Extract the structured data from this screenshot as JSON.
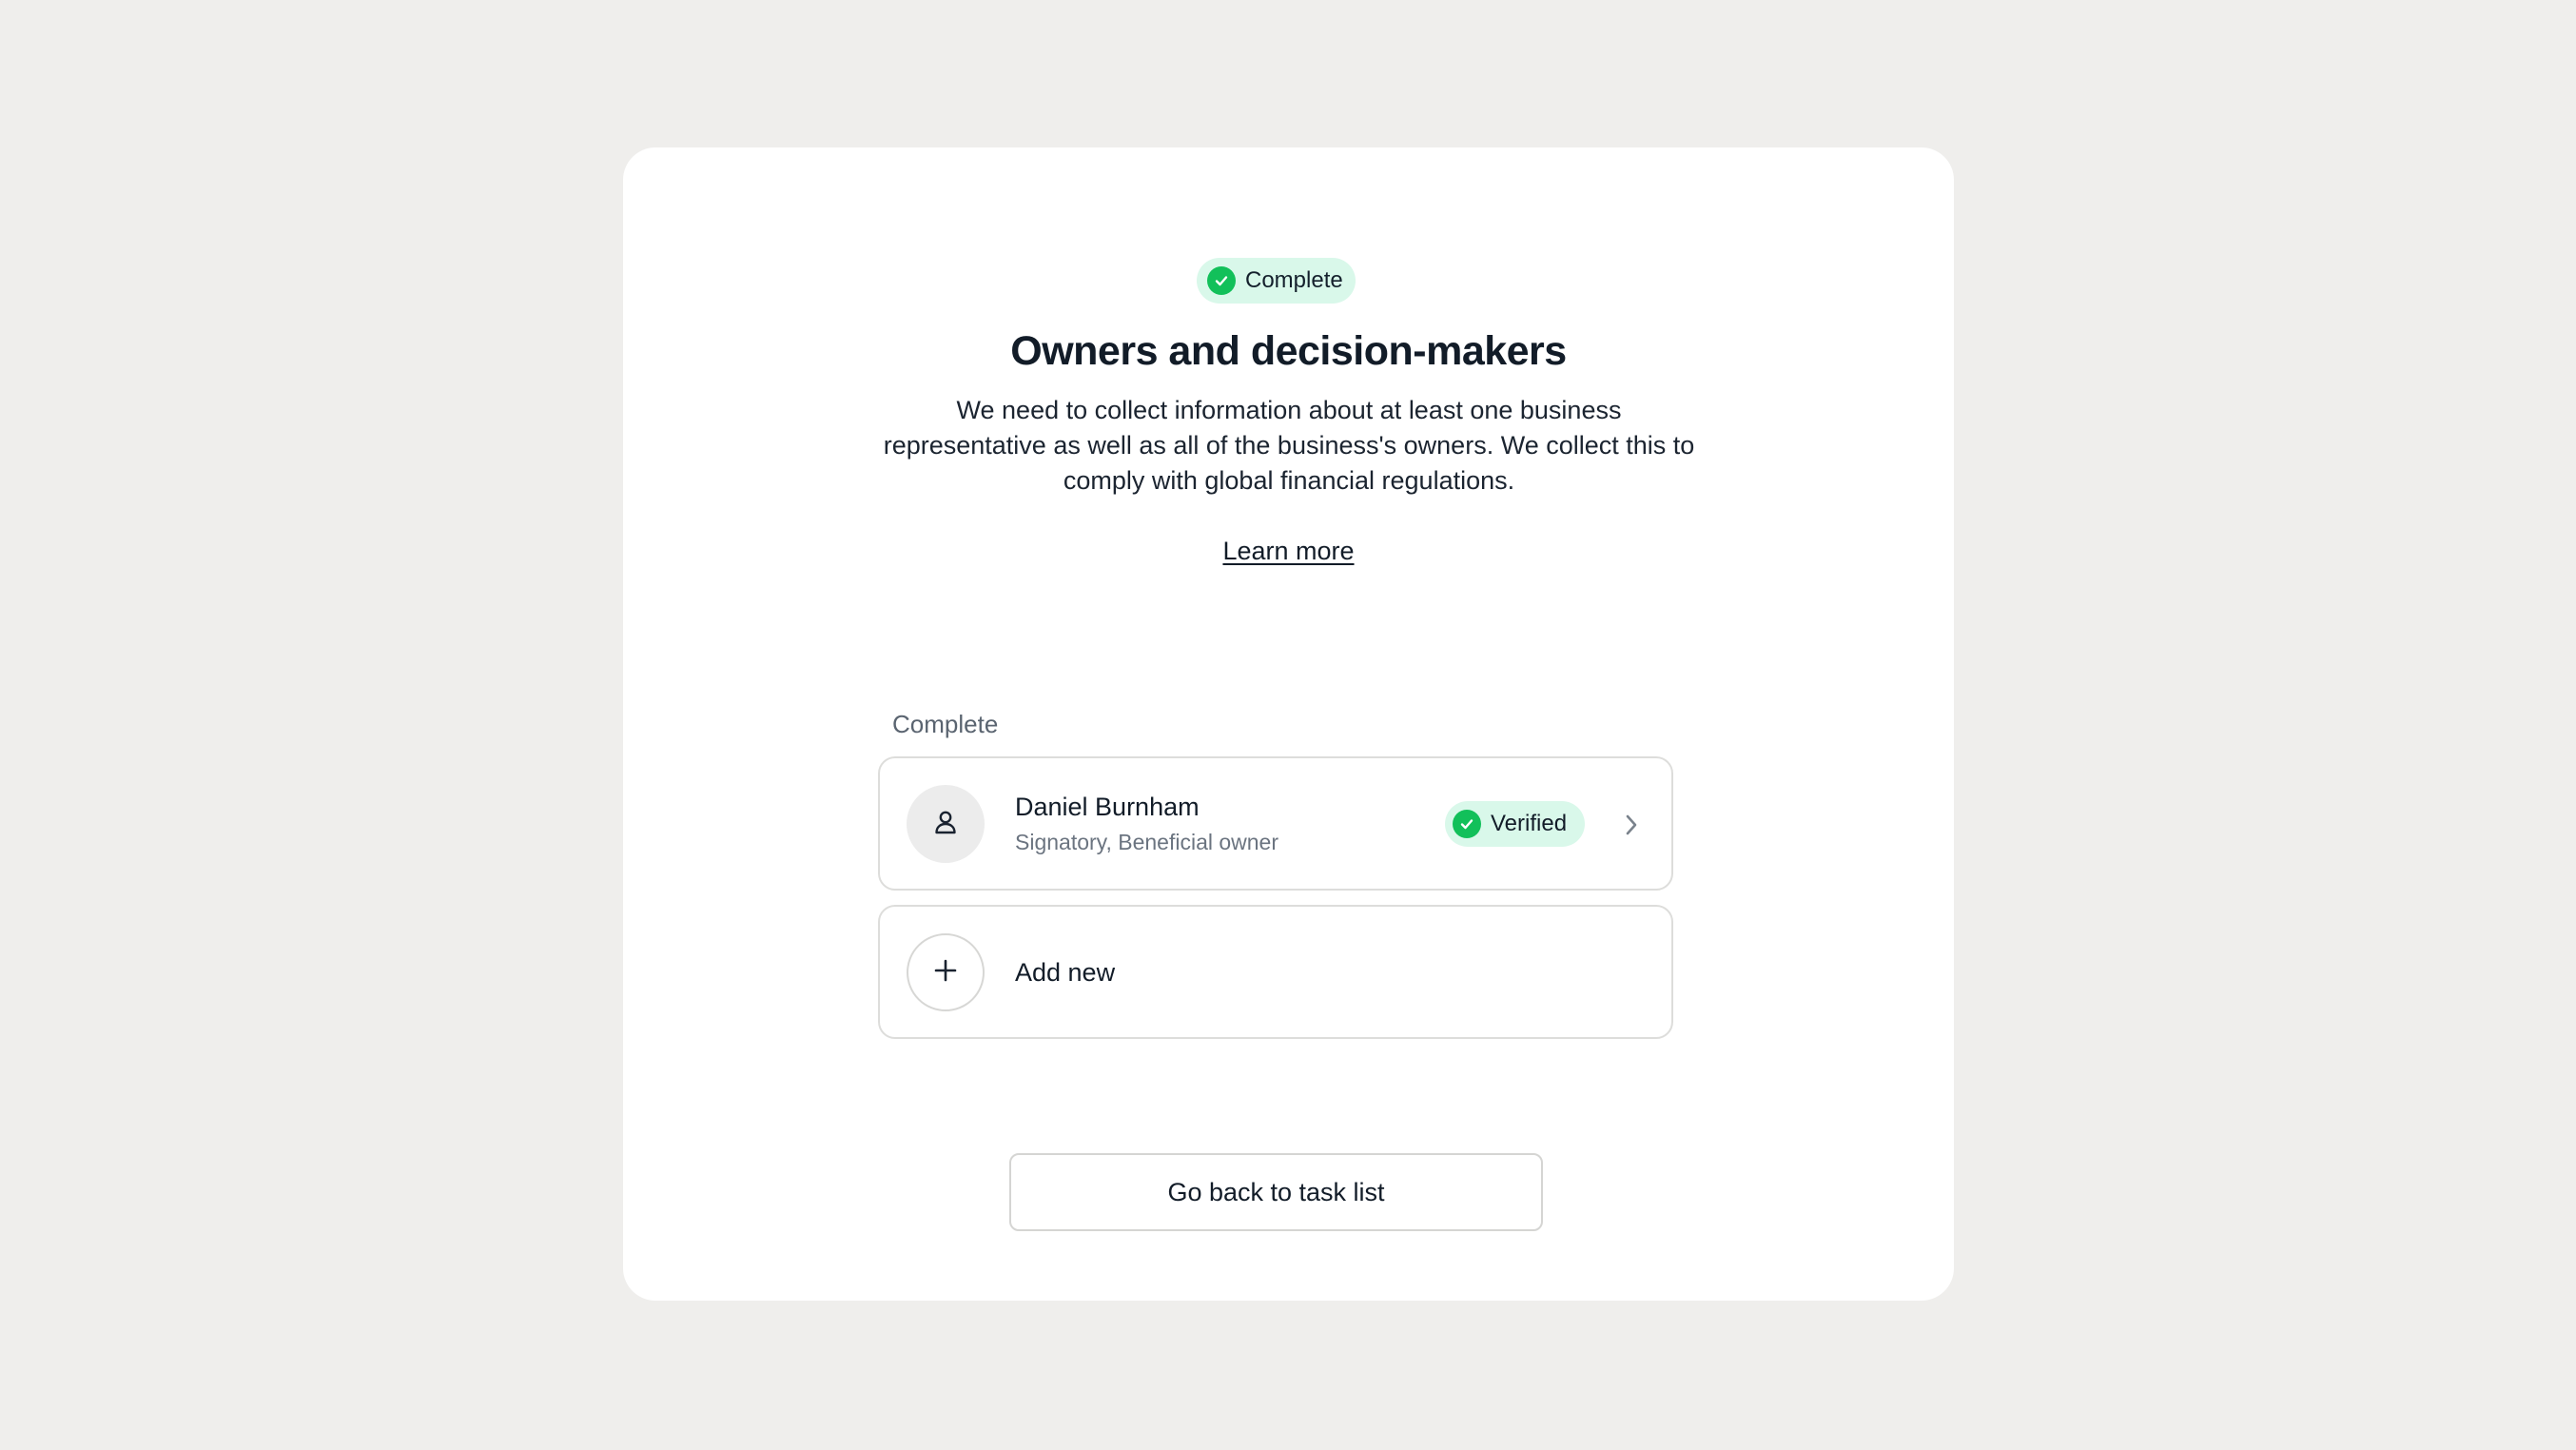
{
  "header": {
    "status_label": "Complete",
    "title": "Owners and decision-makers",
    "description": "We need to collect information about at least one business representative as well as all of the business's owners. We collect this to comply with global financial regulations.",
    "learn_more_label": "Learn more"
  },
  "section": {
    "label": "Complete"
  },
  "people": [
    {
      "name": "Daniel Burnham",
      "roles": "Signatory, Beneficial owner",
      "status": "Verified",
      "icon": "person-icon"
    }
  ],
  "add_new": {
    "label": "Add new",
    "icon": "plus-icon"
  },
  "footer": {
    "back_button_label": "Go back to task list"
  },
  "colors": {
    "background": "#efeeec",
    "card": "#ffffff",
    "success_pill": "#d9f8ea",
    "success_icon": "#12c05a",
    "text_primary": "#121c28",
    "text_secondary": "#6b7480",
    "border": "#dddddb"
  }
}
